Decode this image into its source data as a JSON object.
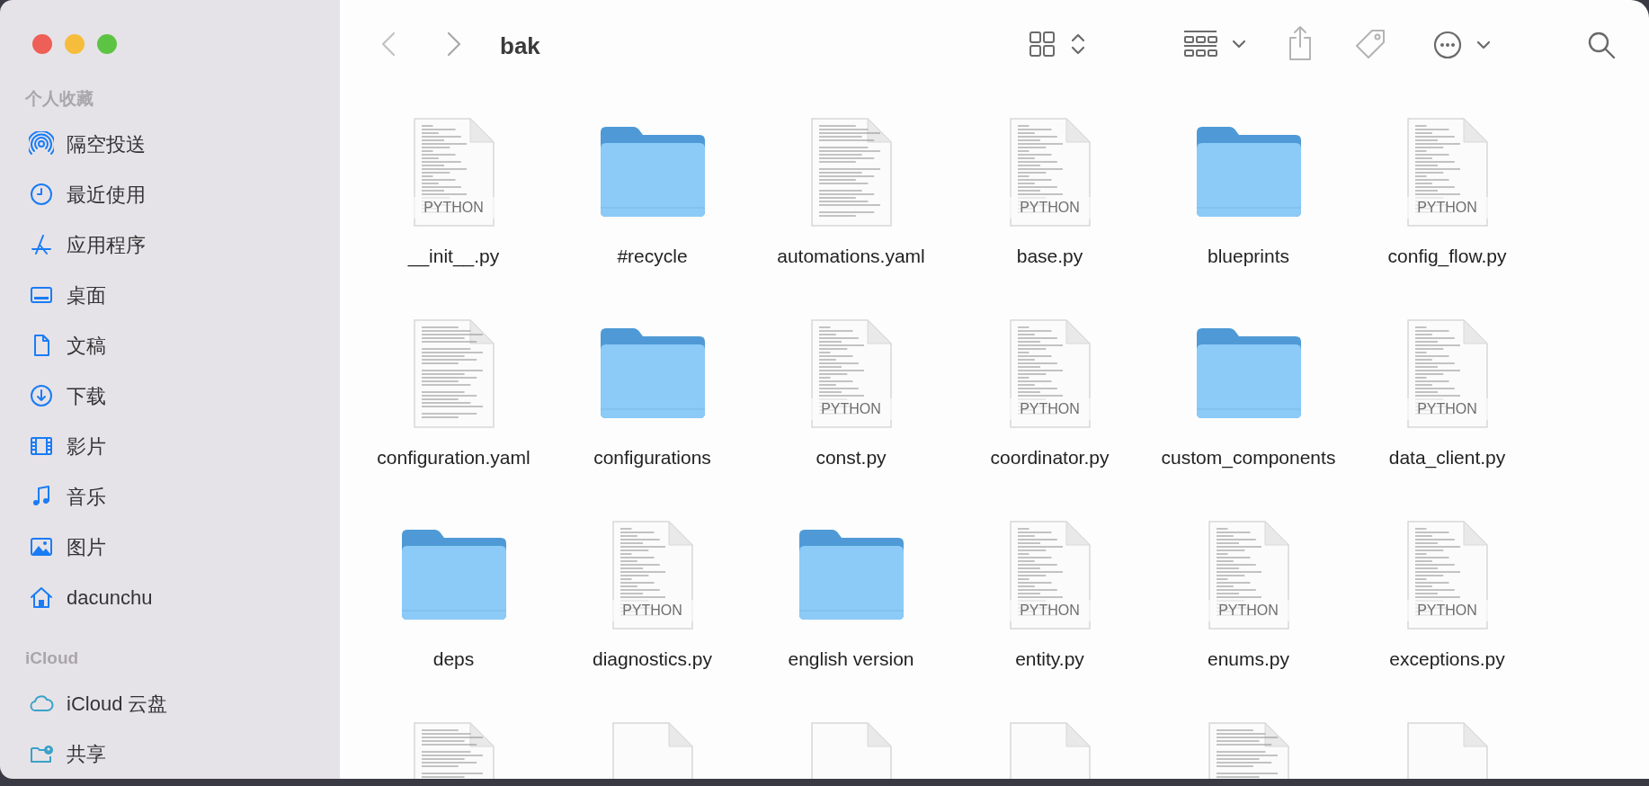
{
  "window": {
    "title": "bak"
  },
  "sidebar": {
    "sections": [
      {
        "title": "个人收藏",
        "items": [
          {
            "label": "隔空投送",
            "kind": "airdrop"
          },
          {
            "label": "最近使用",
            "kind": "recents"
          },
          {
            "label": "应用程序",
            "kind": "apps"
          },
          {
            "label": "桌面",
            "kind": "desktop"
          },
          {
            "label": "文稿",
            "kind": "documents"
          },
          {
            "label": "下载",
            "kind": "downloads"
          },
          {
            "label": "影片",
            "kind": "movies"
          },
          {
            "label": "音乐",
            "kind": "music"
          },
          {
            "label": "图片",
            "kind": "pictures"
          },
          {
            "label": "dacunchu",
            "kind": "home"
          }
        ]
      },
      {
        "title": "iCloud",
        "items": [
          {
            "label": "iCloud 云盘",
            "kind": "icloud"
          },
          {
            "label": "共享",
            "kind": "shared"
          }
        ]
      }
    ]
  },
  "files": [
    {
      "name": "__init__.py",
      "kind": "python",
      "icon_text": "PYTHON"
    },
    {
      "name": "#recycle",
      "kind": "folder"
    },
    {
      "name": "automations.yaml",
      "kind": "text"
    },
    {
      "name": "base.py",
      "kind": "python",
      "icon_text": "PYTHON"
    },
    {
      "name": "blueprints",
      "kind": "folder"
    },
    {
      "name": "config_flow.py",
      "kind": "python",
      "icon_text": "PYTHON"
    },
    {
      "name": "configuration.yaml",
      "kind": "text"
    },
    {
      "name": "configurations",
      "kind": "folder"
    },
    {
      "name": "const.py",
      "kind": "python",
      "icon_text": "PYTHON"
    },
    {
      "name": "coordinator.py",
      "kind": "python",
      "icon_text": "PYTHON"
    },
    {
      "name": "custom_components",
      "kind": "folder"
    },
    {
      "name": "data_client.py",
      "kind": "python",
      "icon_text": "PYTHON"
    },
    {
      "name": "deps",
      "kind": "folder"
    },
    {
      "name": "diagnostics.py",
      "kind": "python",
      "icon_text": "PYTHON"
    },
    {
      "name": "english version",
      "kind": "folder"
    },
    {
      "name": "entity.py",
      "kind": "python",
      "icon_text": "PYTHON"
    },
    {
      "name": "enums.py",
      "kind": "python",
      "icon_text": "PYTHON"
    },
    {
      "name": "exceptions.py",
      "kind": "python",
      "icon_text": "PYTHON"
    },
    {
      "kind": "text"
    },
    {
      "kind": "blank"
    },
    {
      "kind": "blank"
    },
    {
      "kind": "blank"
    },
    {
      "kind": "text"
    },
    {
      "kind": "blank"
    }
  ]
}
